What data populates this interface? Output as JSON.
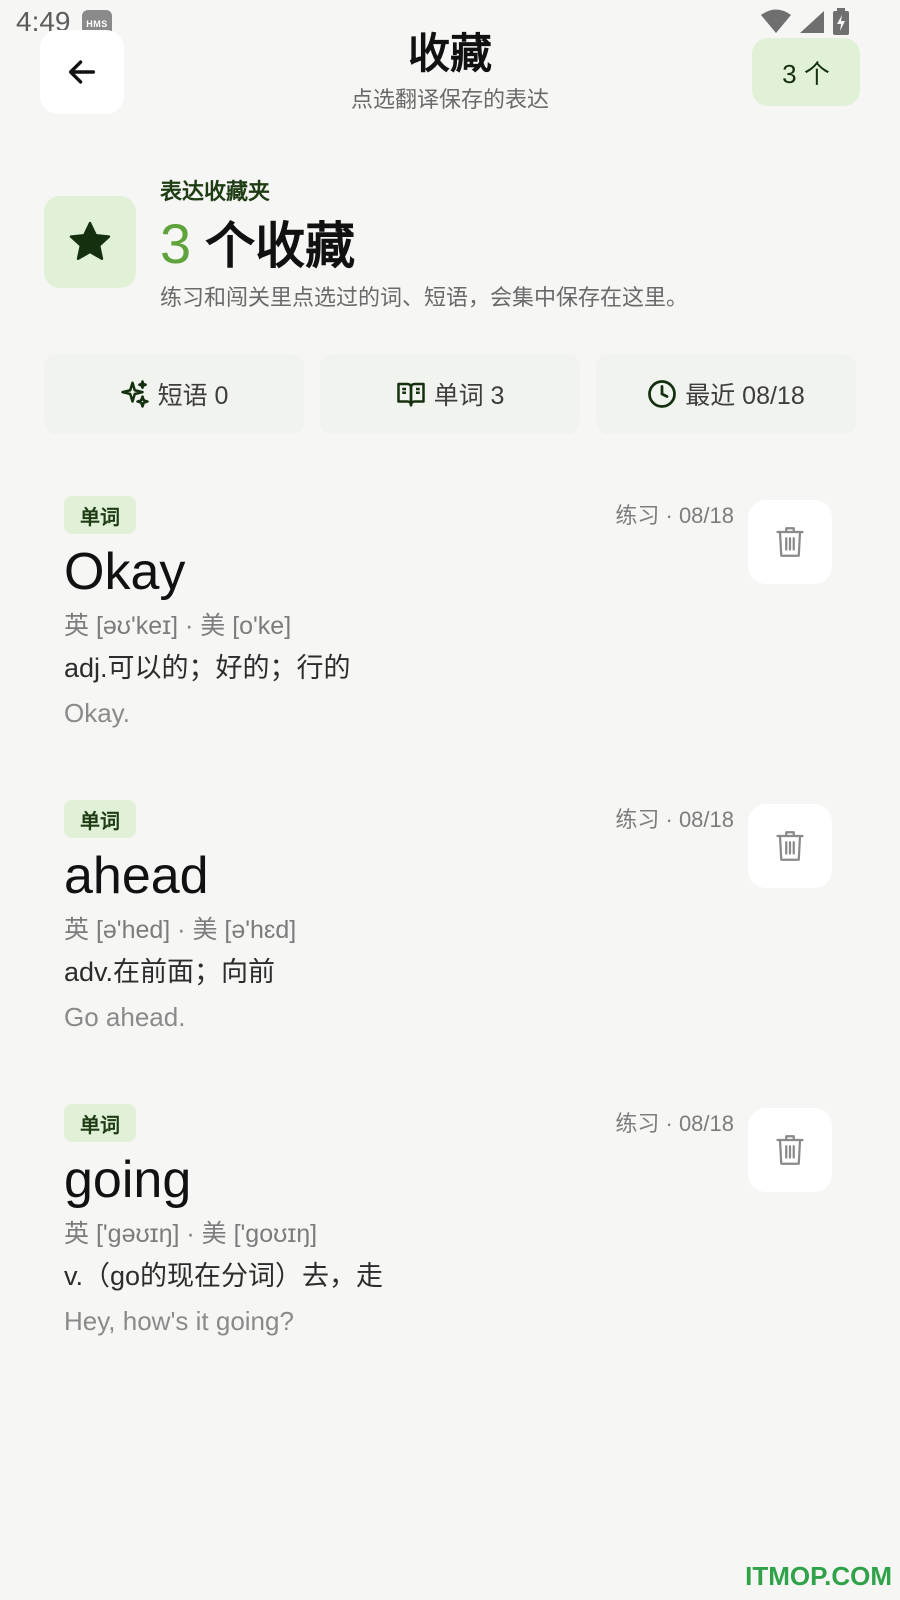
{
  "status_bar": {
    "time": "4:49",
    "badge": "HMS",
    "icons": [
      "wifi-icon",
      "signal-icon",
      "battery-charging-icon"
    ]
  },
  "header": {
    "title": "收藏",
    "subtitle": "点选翻译保存的表达",
    "count_label": "3 个"
  },
  "summary": {
    "section_label": "表达收藏夹",
    "count": "3",
    "count_unit": "个收藏",
    "description": "练习和闯关里点选过的词、短语，会集中保存在这里。"
  },
  "stats": [
    {
      "icon": "sparkle-icon",
      "label": "短语 0"
    },
    {
      "icon": "book-icon",
      "label": "单词 3"
    },
    {
      "icon": "clock-icon",
      "label": "最近 08/18"
    }
  ],
  "favorites": [
    {
      "type": "单词",
      "meta": "练习 · 08/18",
      "word": "Okay",
      "phonetic": "英 [əʊ'keɪ] · 美 [o'ke]",
      "meaning": "adj.可以的；好的；行的",
      "example": "Okay."
    },
    {
      "type": "单词",
      "meta": "练习 · 08/18",
      "word": "ahead",
      "phonetic": "英 [ə'hed] · 美 [ə'hɛd]",
      "meaning": "adv.在前面；向前",
      "example": "Go ahead."
    },
    {
      "type": "单词",
      "meta": "练习 · 08/18",
      "word": "going",
      "phonetic": "英 ['ɡəʊɪŋ] · 美 ['ɡoʊɪŋ]",
      "meaning": "v.（go的现在分词）去，走",
      "example": "Hey, how's it going?"
    }
  ],
  "watermark": "ITMOP.COM",
  "colors": {
    "accent": "#5fa33c",
    "accent_bg": "#e1f1d8",
    "dark_green": "#15300f",
    "background": "#f6f6f4"
  }
}
